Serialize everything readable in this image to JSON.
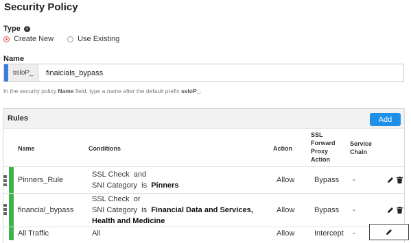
{
  "page": {
    "title": "Security Policy"
  },
  "type": {
    "label": "Type",
    "options": [
      {
        "label": "Create New",
        "selected": true
      },
      {
        "label": "Use Existing",
        "selected": false
      }
    ]
  },
  "name": {
    "label": "Name",
    "prefix": "ssloP_",
    "value": "finaicials_bypass",
    "hint_before": "In the security policy ",
    "hint_bold1": "Name",
    "hint_middle": " field, type a name after the default prefix ",
    "hint_bold2": "ssloP_",
    "hint_after": "."
  },
  "rules": {
    "title": "Rules",
    "add_label": "Add",
    "columns": {
      "name": "Name",
      "conditions": "Conditions",
      "action": "Action",
      "ssl_line1": "SSL",
      "ssl_line2": "Forward",
      "ssl_line3": "Proxy",
      "ssl_line4": "Action",
      "chain_line1": "Service",
      "chain_line2": "Chain"
    },
    "rows": [
      {
        "name": "Pinners_Rule",
        "cond1_text": "SSL Check  and",
        "cond2_text": "SNI Category  is  ",
        "cond2_bold": "Pinners",
        "cond3_bold": "",
        "action": "Allow",
        "ssl_action": "Bypass",
        "chain": "-"
      },
      {
        "name": "financial_bypass",
        "cond1_text": "SSL Check  or",
        "cond2_text": "SNI Category  is  ",
        "cond2_bold": "Financial Data and Services,",
        "cond3_bold": "Health and Medicine",
        "action": "Allow",
        "ssl_action": "Bypass",
        "chain": "-"
      },
      {
        "name": "All Traffic",
        "cond1_text": "All",
        "action": "Allow",
        "ssl_action": "Intercept",
        "chain": "-"
      }
    ]
  },
  "colors": {
    "accent_blue": "#1e90e8",
    "status_green": "#3cb44b",
    "radio_red": "#d9534f"
  }
}
